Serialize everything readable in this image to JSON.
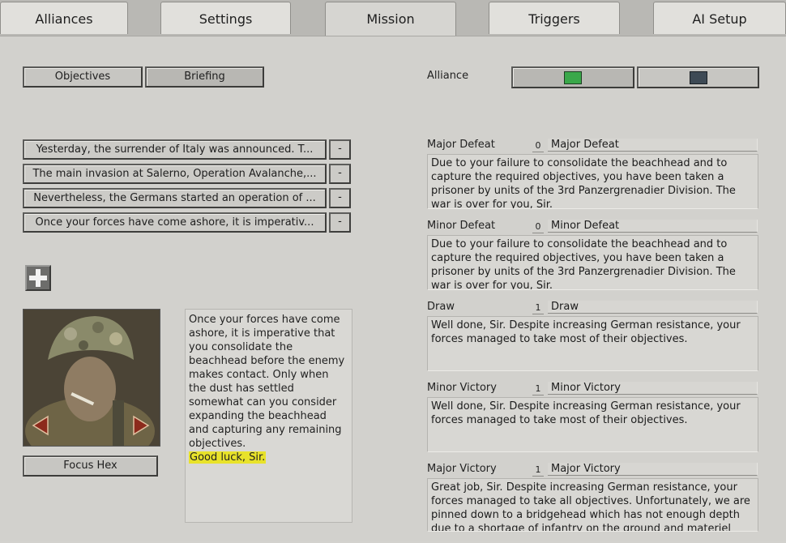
{
  "tabs": [
    {
      "label": "Alliances",
      "active": false
    },
    {
      "label": "Settings",
      "active": false
    },
    {
      "label": "Mission",
      "active": true
    },
    {
      "label": "Triggers",
      "active": false
    },
    {
      "label": "AI Setup",
      "active": false
    }
  ],
  "mission": {
    "objectives_label": "Objectives",
    "briefing_label": "Briefing",
    "alliance_label": "Alliance",
    "alliance_colors": [
      "#3aa84a",
      "#3e4a55"
    ],
    "briefing_lines": [
      "Yesterday, the surrender of Italy was announced. T...",
      "The main invasion at Salerno, Operation Avalanche,...",
      "Nevertheless, the Germans started an operation of ...",
      "Once your forces have come ashore, it is imperativ..."
    ],
    "remove_label": "-",
    "add_icon": "plus-icon",
    "focus_hex_label": "Focus Hex",
    "briefing_text": "Once your forces have come ashore, it is imperative that you consolidate the beachhead before the enemy makes contact. Only when the dust has settled somewhat can you consider expanding the beachhead and capturing any remaining objectives.",
    "briefing_highlight": "Good luck, Sir."
  },
  "outcomes": [
    {
      "label": "Major Defeat",
      "value": "0",
      "title": "Major Defeat",
      "text": "Due to your failure to consolidate the beachhead and to capture the required objectives, you have been taken a prisoner by units of the 3rd Panzergrenadier Division. The war is over for you, Sir."
    },
    {
      "label": "Minor Defeat",
      "value": "0",
      "title": "Minor Defeat",
      "text": "Due to your failure to consolidate the beachhead and to capture the required objectives, you have been taken a prisoner by units of the 3rd Panzergrenadier Division. The war is over for you, Sir."
    },
    {
      "label": "Draw",
      "value": "1",
      "title": "Draw",
      "text": "Well done, Sir. Despite increasing German resistance, your forces managed to take most of their objectives."
    },
    {
      "label": "Minor Victory",
      "value": "1",
      "title": "Minor Victory",
      "text": "Well done, Sir. Despite increasing German resistance, your forces managed to take most of their objectives."
    },
    {
      "label": "Major Victory",
      "value": "1",
      "title": "Major Victory",
      "text": "Great job, Sir. Despite increasing German resistance, your forces managed to take all objectives. Unfortunately, we are pinned down to a bridgehead which has not enough depth due to a shortage of infantry on the ground and materiel"
    }
  ]
}
